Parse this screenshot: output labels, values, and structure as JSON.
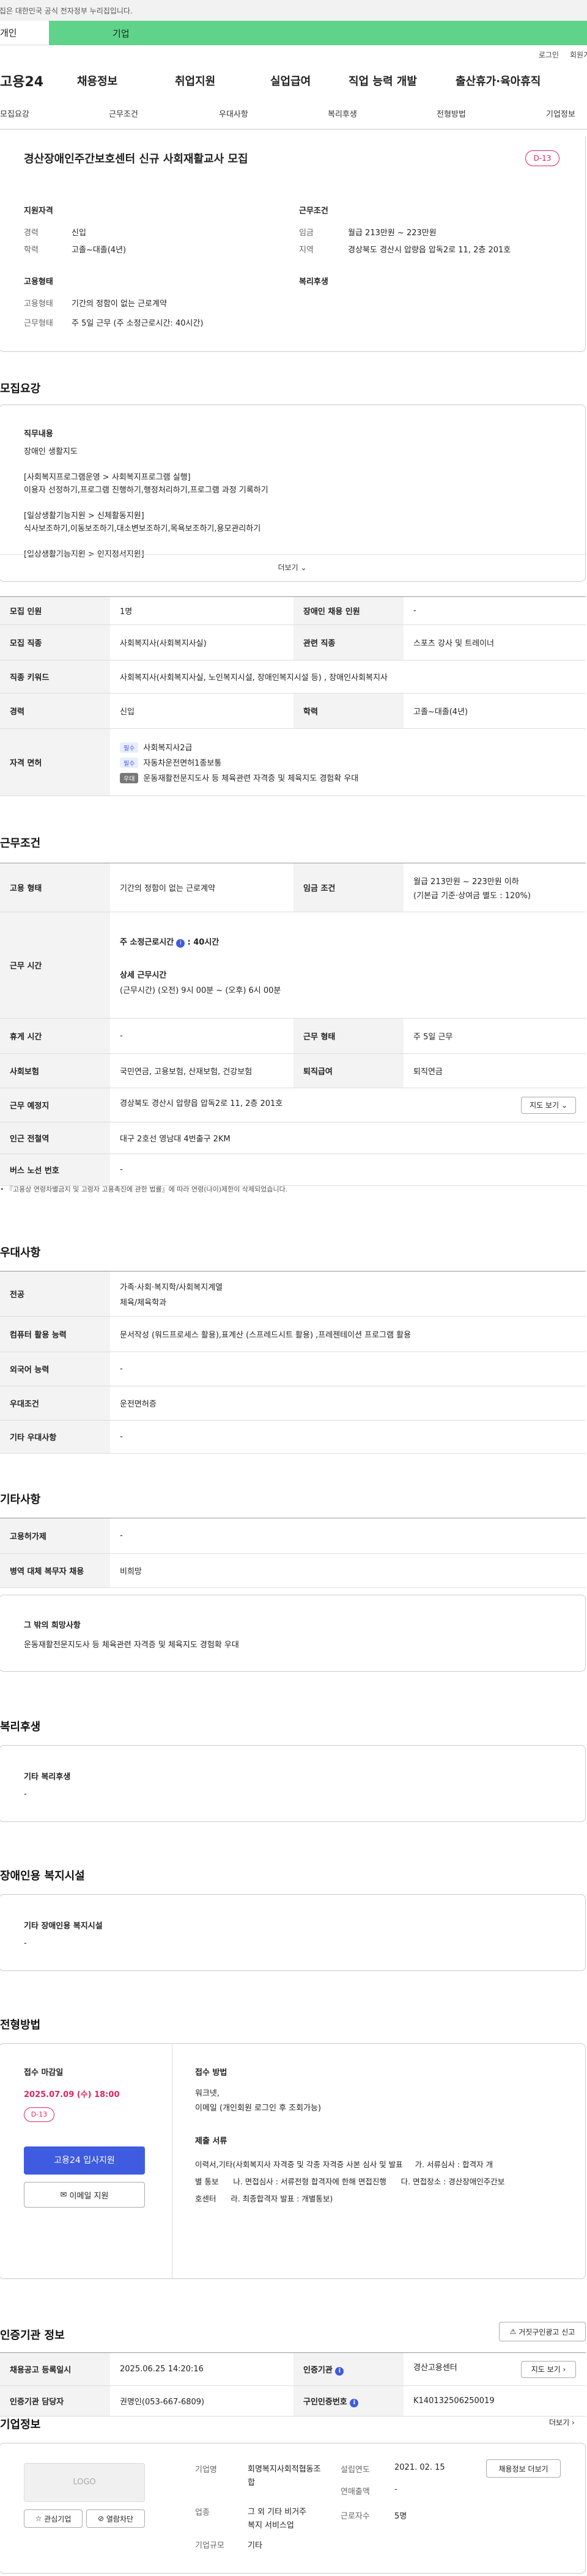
{
  "gov_banner": "이 누리집은 대한민국 공식 전자정부 누리집입니다.",
  "top_tabs": [
    "개인",
    "기업"
  ],
  "util_links": [
    "로그인",
    "회원가입"
  ],
  "logo": "고용24",
  "gnb": [
    "채용정보",
    "취업지원",
    "실업급여",
    "직업 능력 개발",
    "출산휴가·육아휴직"
  ],
  "page_tabs": [
    "모집요강",
    "근무조건",
    "우대사항",
    "복리후생",
    "전형방법",
    "기업정보"
  ],
  "summary": {
    "title": "경산장애인주간보호센터 신규 사회재활교사 모집",
    "dday": "D-13",
    "qual_title": "지원자격",
    "career_label": "경력",
    "career": "신입",
    "edu_label": "학력",
    "edu": "고졸~대졸(4년)",
    "work_title": "근무조건",
    "wage_label": "임금",
    "wage": "월급 213만원 ~ 223만원",
    "region_label": "지역",
    "region": "경상북도 경산시 압량읍 압독2로 11, 2층 201호",
    "emp_title": "고용형태",
    "type_label": "고용형태",
    "type": "기간의 정함이 없는 근로계약",
    "hours_label": "근무형태",
    "hours": "주 5일 근무 (주 소정근로시간: 40시간)",
    "welfare_title": "복리후생"
  },
  "recruit": {
    "section": "모집요강",
    "duty_title": "직무내용",
    "duty_lines": [
      "장애인 생활지도",
      "",
      "[사회복지프로그램운영 > 사회복지프로그램 실행]",
      "이용자 선정하기,프로그램 진행하기,행정처리하기,프로그램 과정 기록하기",
      "",
      "[일상생활기능지원 > 신체활동지원]",
      "식사보조하기,이동보조하기,대소변보조하기,목욕보조하기,용모관리하기",
      "",
      "[일상생활기능지원 > 인지정서지원]"
    ],
    "more": "더보기",
    "rows": [
      {
        "h1": "모집 인원",
        "v1": "1명",
        "h2": "장애인 채용 인원",
        "v2": "-"
      },
      {
        "h1": "모집 직종",
        "v1": "사회복지사(사회복지사실)",
        "h2": "관련 직종",
        "v2": "스포츠 강사 및 트레이너"
      },
      {
        "h1": "직종 키워드",
        "v1": "사회복지사(사회복지사실, 노인복지시설, 장애인복지시설 등) , 장애인사회복지사"
      },
      {
        "h1": "경력",
        "v1": "신입",
        "h2": "학력",
        "v2": "고졸~대졸(4년)"
      }
    ],
    "license_label": "자격 면허",
    "licenses": [
      {
        "tag": "필수",
        "name": "사회복지사2급"
      },
      {
        "tag": "필수",
        "name": "자동차운전면허1종보통"
      },
      {
        "tag": "우대",
        "name": "운동재활전문지도사 등 체육관련 자격증 및 체육지도 경험확 우대"
      }
    ]
  },
  "work": {
    "section": "근무조건",
    "type_label": "고용 형태",
    "type": "기간의 정함이 없는 근로계약",
    "wage_label": "임금 조건",
    "wage1": "월급 213만원 ~ 223만원 이하",
    "wage2": "(기본급 기준·상여금 별도 : 120%)",
    "time_label": "근무 시간",
    "time_week": "주 소정근로시간",
    "time_week_val": ": 40시간",
    "time_detail_title": "상세 근무시간",
    "time_detail": "(근무시간) (오전) 9시 00분 ~ (오후) 6시 00분",
    "rest_label": "휴게 시간",
    "rest": "-",
    "form_label": "근무 형태",
    "form": "주 5일 근무",
    "ins_label": "사회보험",
    "ins": "국민연금, 고용보험, 산재보험, 건강보험",
    "ret_label": "퇴직급여",
    "ret": "퇴직연금",
    "place_label": "근무 예정지",
    "place": "경상북도 경산시 압량읍 압독2로 11, 2층 201호",
    "map_btn": "지도 보기",
    "subway_label": "인근 전철역",
    "subway": "대구 2호선 영남대 4번출구 2KM",
    "bus_label": "버스 노선 번호",
    "bus": "-",
    "note": "『고용상 연령차별금지 및 고령자 고용촉진에 관한 법률』에 따라 연령(나이)제한이 삭제되었습니다."
  },
  "pref": {
    "section": "우대사항",
    "rows": [
      {
        "h": "전공",
        "v1": "가족·사회·복지학/사회복지계열",
        "v2": "체육/체육학과"
      },
      {
        "h": "컴퓨터 활용 능력",
        "v1": "문서작성 (워드프로세스 활용),표계산 (스프레드시트 활용) ,프레젠테이션 프로그램 활용"
      },
      {
        "h": "외국어 능력",
        "v1": "-"
      },
      {
        "h": "우대조건",
        "v1": "운전면허증"
      },
      {
        "h": "기타 우대사항",
        "v1": "-"
      }
    ]
  },
  "etc": {
    "section": "기타사항",
    "rows": [
      {
        "h": "고용허가제",
        "v": "-"
      },
      {
        "h": "병역 대체 복무자 채용",
        "v": "비희망"
      }
    ],
    "box_title": "그 밖의 희망사항",
    "box_text": "운동재활전문지도사 등 체육관련 자격증 및 체육지도 경험확 우대"
  },
  "welfare": {
    "section": "복리후생",
    "box_title": "기타 복리후생",
    "box_text": "-"
  },
  "disabled": {
    "section": "장애인용 복지시설",
    "box_title": "기타 장애인용 복지시설",
    "box_text": "-"
  },
  "apply": {
    "section": "전형방법",
    "deadline_title": "접수 마감일",
    "deadline": "2025.07.09 (수) 18:00",
    "dday": "D-13",
    "apply_btn": "고용24 입사지원",
    "email_btn": "이메일 지원",
    "method_title": "접수 방법",
    "method_lines": [
      "워크넷,",
      "이메일 (개인회원 로그인 후 조회가능)"
    ],
    "docs_title": "제출 서류",
    "docs_lines": [
      "이력서,기타(사회복지사 자격증 및 각종 자격증 사본 심사 및 발표     가. 서류심사 : 합격자 개",
      "별 통보      나. 면접심사 : 서류전형 합격자에 한해 면접진행      다. 면접장소 : 경산장애인주간보",
      "호센터      라. 최종합격자 발표 : 개별통보)"
    ]
  },
  "agency": {
    "section": "인증기관 정보",
    "report_btn": "거짓구인광고 신고",
    "rows": [
      {
        "h1": "채용공고 등록일시",
        "v1": "2025.06.25 14:20:16",
        "h2": "인증기관",
        "v2": "경산고용센터",
        "btn": "지도 보기"
      },
      {
        "h1": "인증기관 담당자",
        "v1": "권명인(053-667-6809)",
        "h2": "구인인증번호",
        "v2": "K140132506250019"
      }
    ]
  },
  "company": {
    "section": "기업정보",
    "more": "더보기",
    "logo": "LOGO",
    "fav_btn": "관심기업",
    "block_btn": "열람차단",
    "name_label": "기업명",
    "name": "회명복지사회적협동조합",
    "founded_label": "설립연도",
    "founded": "2021. 02. 15",
    "sales_label": "연매출액",
    "sales": "-",
    "industry_label": "업종",
    "industry1": "그 외 기타 비거주",
    "industry2": "복지 서비스업",
    "emp_label": "근로자수",
    "emp": "5명",
    "size_label": "기업규모",
    "size": "기타",
    "detail_btn": "채용정보 더보기"
  },
  "colors": {
    "accent": "#5fd38a",
    "primary": "#3f5be0",
    "danger": "#e0245e"
  }
}
